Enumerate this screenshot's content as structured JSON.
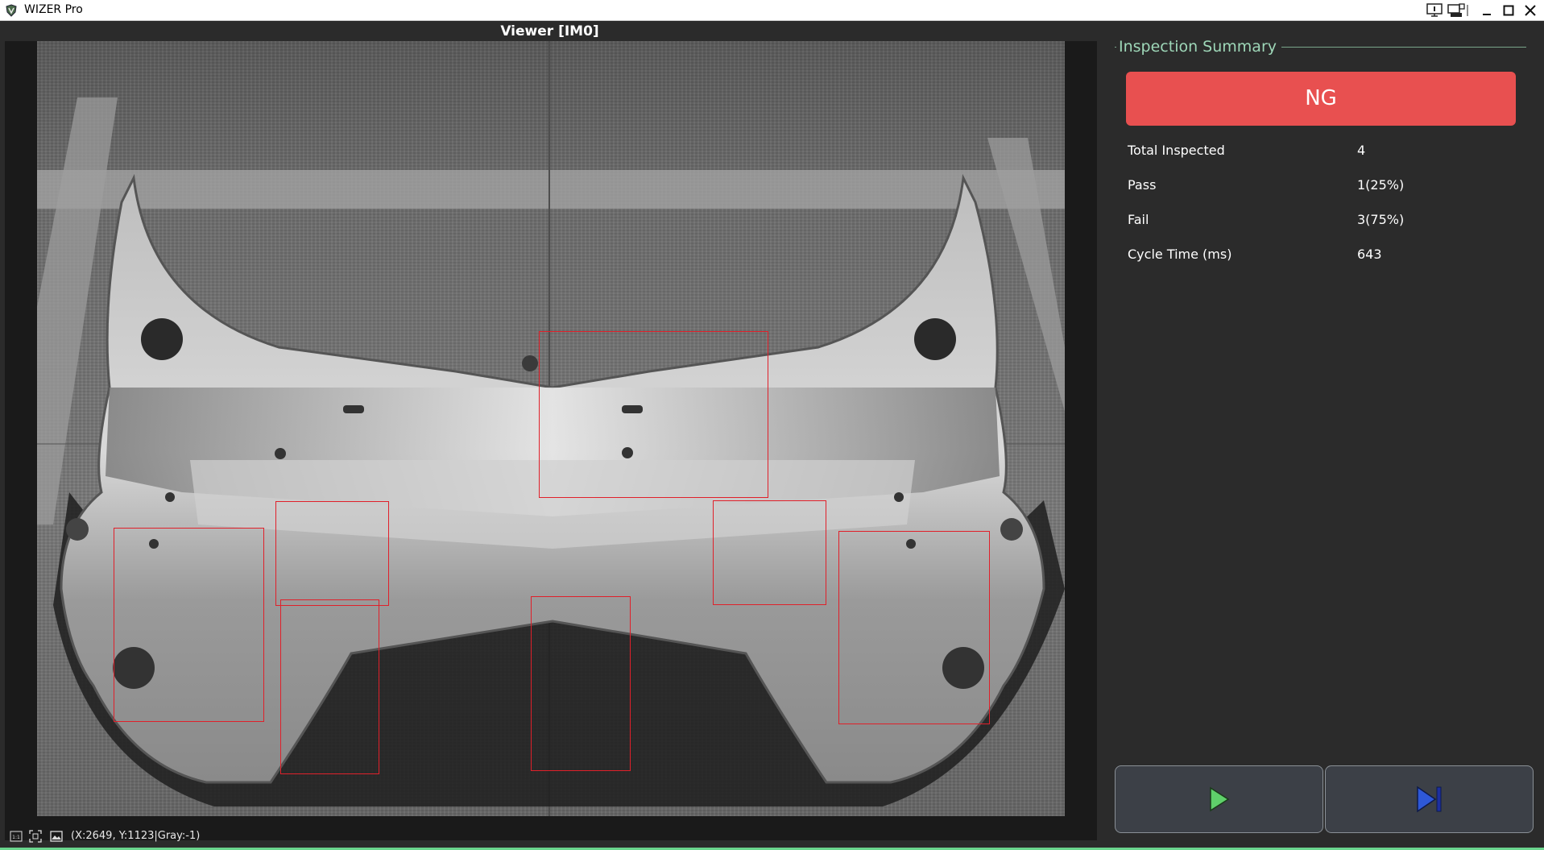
{
  "window": {
    "title": "WIZER Pro"
  },
  "viewer": {
    "title": "Viewer  [IM0]",
    "status_text": "(X:2649, Y:1123|Gray:-1)",
    "roi_color": "#e0202a"
  },
  "summary": {
    "group_title": "Inspection Summary",
    "result": "NG",
    "result_color": "#e85050",
    "rows": [
      {
        "label": "Total Inspected",
        "value": "4"
      },
      {
        "label": "Pass",
        "value": "1(25%)"
      },
      {
        "label": "Fail",
        "value": "3(75%)"
      },
      {
        "label": "Cycle Time (ms)",
        "value": "643"
      }
    ]
  },
  "controls": {
    "run_icon": "play-icon",
    "run_color": "#5fd06a",
    "step_icon": "step-forward-icon",
    "step_color": "#2e58d8"
  },
  "icons": {
    "app": "app-shield-icon",
    "statusbar": [
      "fit-1to1-icon",
      "fit-window-icon",
      "image-icon"
    ],
    "titlebar": [
      "monitor-icon",
      "settings-panel-icon",
      "minimize-icon",
      "maximize-icon",
      "close-icon"
    ]
  }
}
